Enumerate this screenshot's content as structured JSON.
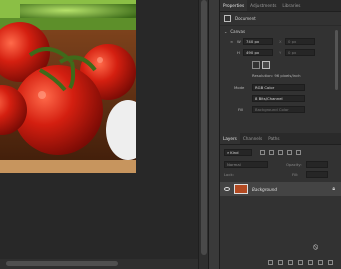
{
  "properties_panel": {
    "tabs": [
      "Properties",
      "Adjustments",
      "Libraries"
    ],
    "document_label": "Document",
    "canvas_section": "Canvas",
    "width_label": "W",
    "width_value": "740 px",
    "height_label": "H",
    "height_value": "490 px",
    "x_label": "X",
    "x_value": "0 px",
    "y_label": "Y",
    "y_value": "0 px",
    "resolution": "Resolution: 96 pixels/inch",
    "mode_label": "Mode",
    "mode_value": "RGB Color",
    "depth_value": "8 Bits/Channel",
    "fill_label": "Fill",
    "fill_value": "Background Color"
  },
  "layers_panel": {
    "tabs": [
      "Layers",
      "Channels",
      "Paths"
    ],
    "kind_label": "Kind",
    "blend_mode": "Normal",
    "opacity_label": "Opacity:",
    "lock_label": "Lock:",
    "fill_label": "Fill:",
    "layer_name": "Background"
  }
}
